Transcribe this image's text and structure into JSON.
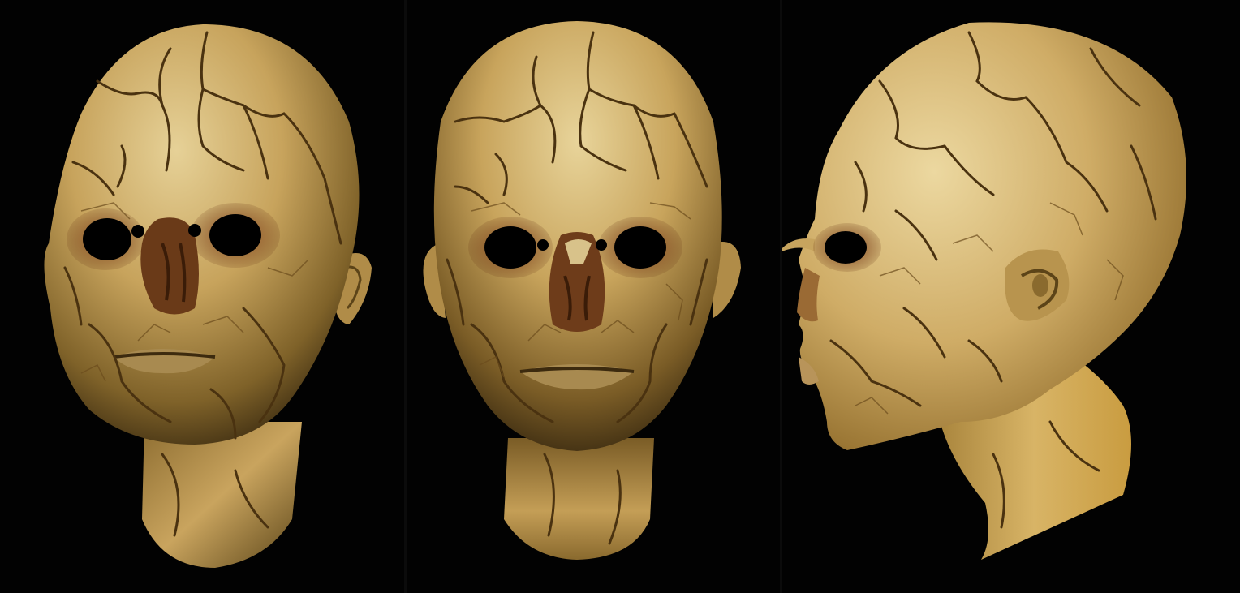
{
  "image": {
    "background_color": "#020202",
    "skin_highlight": "#e8d49a",
    "skin_mid": "#c9a45e",
    "skin_shadow": "#6e5424",
    "crack_color": "#4a3210",
    "socket_color": "#000000",
    "flesh_tint": "#8a4a22",
    "views": [
      {
        "name": "three-quarter-front"
      },
      {
        "name": "front"
      },
      {
        "name": "right-profile"
      }
    ]
  }
}
